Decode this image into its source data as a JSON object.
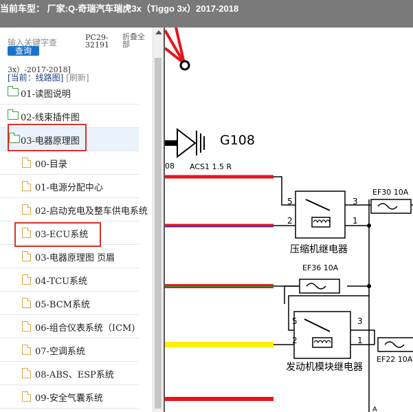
{
  "window": {
    "title": "当前车型： 厂家:Q-奇瑞汽车瑞虎3x（Tiggo 3x）2017-2018"
  },
  "sidebar": {
    "search_placeholder": "输入关键字查",
    "search_button": "查询",
    "pc_code": "PC29-32191",
    "collapse_all": "折叠全部",
    "truncated_model": "3x）-2017-2018]",
    "current_label": "[当前：线路图]",
    "refresh_label": "[刷新]",
    "tree": [
      {
        "label": "01-读图说明",
        "icon": "folder-icon"
      },
      {
        "label": "02-线束插件图",
        "icon": "folder-icon"
      },
      {
        "label": "03-电器原理图",
        "icon": "folder-open-icon",
        "highlighted": true
      },
      {
        "label": "00-目录",
        "icon": "document-icon"
      },
      {
        "label": "01-电源分配中心",
        "icon": "document-icon"
      },
      {
        "label": "02-启动充电及整车供电系统",
        "icon": "document-icon"
      },
      {
        "label": "03-ECU系统",
        "icon": "document-icon",
        "highlighted": true
      },
      {
        "label": "03-电器原理图 页眉",
        "icon": "document-icon"
      },
      {
        "label": "04-TCU系统",
        "icon": "document-icon"
      },
      {
        "label": "05-BCM系统",
        "icon": "document-icon"
      },
      {
        "label": "06-组合仪表系统（ICM)",
        "icon": "document-icon"
      },
      {
        "label": "07-空调系统",
        "icon": "document-icon"
      },
      {
        "label": "08-ABS、ESP系统",
        "icon": "document-icon"
      },
      {
        "label": "09-安全气囊系统",
        "icon": "document-icon"
      }
    ]
  },
  "diagram": {
    "ground_label": "G108",
    "ground_sub": "08",
    "wire_label": "ACS1 1.5 R",
    "fuse_ef30": "EF30 10A",
    "fuse_ef36": "EF36 10A",
    "fuse_ef22": "EF22 10A",
    "relay1_name": "压缩机继电器",
    "relay2_name": "发动机模块继电器",
    "pins": {
      "r1_p5": "5",
      "r1_p3": "3",
      "r1_p2": "2",
      "r1_p1": "1",
      "r2_p5": "5",
      "r2_p3": "3",
      "r2_p2": "2",
      "r2_p1": "1"
    },
    "bottom_mark": "A",
    "colors": {
      "red": "#e8141a",
      "yellow": "#ffef00",
      "green": "#2a8a2a",
      "purple": "#6a2a9a"
    }
  }
}
